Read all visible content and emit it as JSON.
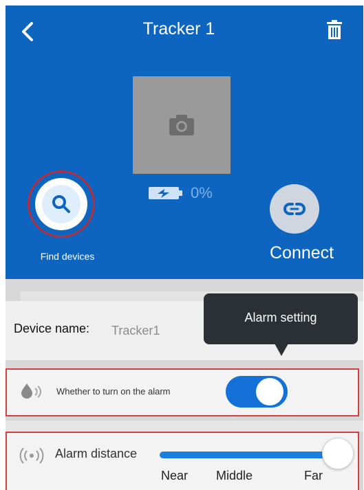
{
  "header": {
    "title": "Tracker 1",
    "back_icon": "chevron-left-icon",
    "delete_icon": "trash-icon"
  },
  "device_photo": {
    "icon": "camera-icon",
    "battery_icon": "battery-charging-icon",
    "battery_text": "0%"
  },
  "actions": {
    "find_label": "Find devices",
    "find_icon": "search-icon",
    "connect_label": "Connect",
    "connect_icon": "link-icon"
  },
  "device_name": {
    "label": "Device name:",
    "value": "Tracker1"
  },
  "tooltip": {
    "text": "Alarm setting"
  },
  "alarm_toggle": {
    "icon": "drop-sound-icon",
    "label": "Whether to turn on the alarm",
    "enabled": true
  },
  "alarm_distance": {
    "icon": "signal-waves-icon",
    "label": "Alarm distance",
    "levels": [
      "Near",
      "Middle",
      "Far"
    ],
    "selected": "Far",
    "slider_fraction": 1.0
  },
  "colors": {
    "header_bg": "#0d65c0",
    "accent": "#1371d8",
    "highlight_border": "#cc4044",
    "tooltip_bg": "#2b2f36"
  }
}
